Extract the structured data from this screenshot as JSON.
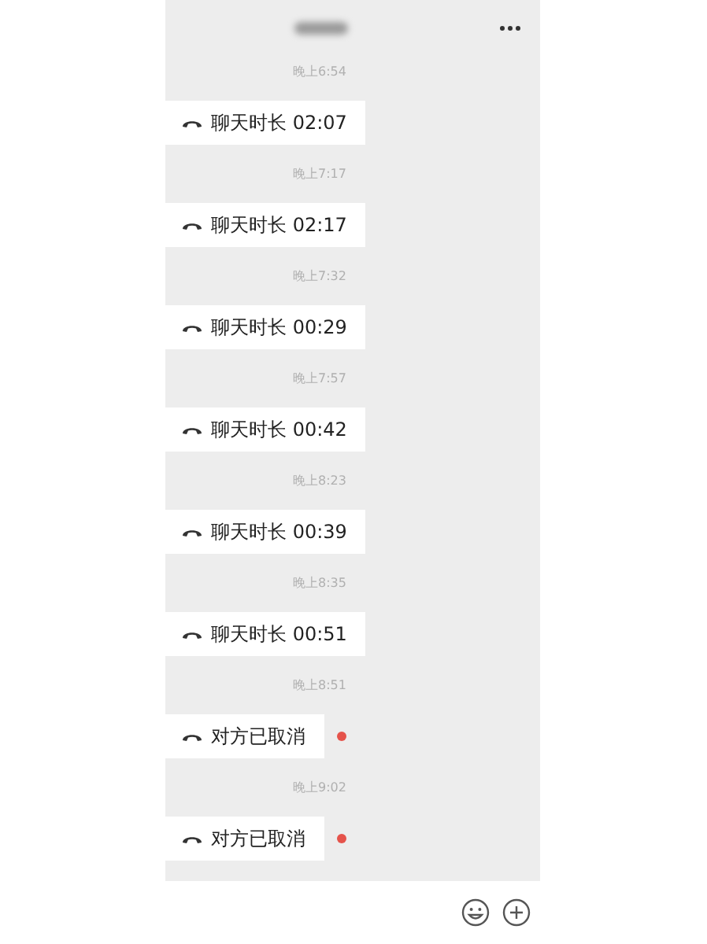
{
  "messages": [
    {
      "time": "晚上6:54",
      "text": "聊天时长 02:07",
      "unread": false
    },
    {
      "time": "晚上7:17",
      "text": "聊天时长 02:17",
      "unread": false
    },
    {
      "time": "晚上7:32",
      "text": "聊天时长 00:29",
      "unread": false
    },
    {
      "time": "晚上7:57",
      "text": "聊天时长 00:42",
      "unread": false
    },
    {
      "time": "晚上8:23",
      "text": "聊天时长 00:39",
      "unread": false
    },
    {
      "time": "晚上8:35",
      "text": "聊天时长 00:51",
      "unread": false
    },
    {
      "time": "晚上8:51",
      "text": "对方已取消",
      "unread": true
    },
    {
      "time": "晚上9:02",
      "text": "对方已取消",
      "unread": true
    }
  ]
}
